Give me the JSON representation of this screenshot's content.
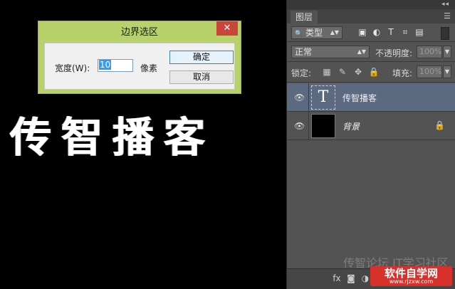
{
  "canvas": {
    "text": "传智播客"
  },
  "dialog": {
    "title": "边界选区",
    "close": "✕",
    "width_label": "宽度(W):",
    "width_value": "10",
    "unit": "像素",
    "ok_label": "确定",
    "cancel_label": "取消"
  },
  "panel": {
    "collapse": "◂◂",
    "tab": "图层",
    "menu": "☰",
    "filter": {
      "icon": "🔍",
      "label": "类型"
    },
    "filter_icons": [
      "▣",
      "◐",
      "T",
      "⌗",
      "▤"
    ],
    "blend_mode": "正常",
    "opacity_label": "不透明度:",
    "opacity_value": "100%",
    "lock_label": "锁定:",
    "lock_icons": [
      "▦",
      "✎",
      "✥",
      "🔒"
    ],
    "fill_label": "填充:",
    "fill_value": "100%",
    "layers": [
      {
        "name": "传智播客",
        "thumb": "T",
        "visible": "👁"
      },
      {
        "name": "背景",
        "visible": "👁",
        "lock": "🔒"
      }
    ],
    "bottom_icons": [
      "fx",
      "◙",
      "◑",
      "▭",
      "▢",
      "🗑"
    ]
  },
  "watermark": {
    "line1": "传智论坛 IT学习社区",
    "logo": "软件自学网",
    "url": "www.rjzxw.com"
  },
  "colors": {
    "dialog_title_bar": "#b9d16a",
    "close_button": "#c9443a",
    "panel_bg": "#535353",
    "selected_layer": "#5b6a80"
  }
}
